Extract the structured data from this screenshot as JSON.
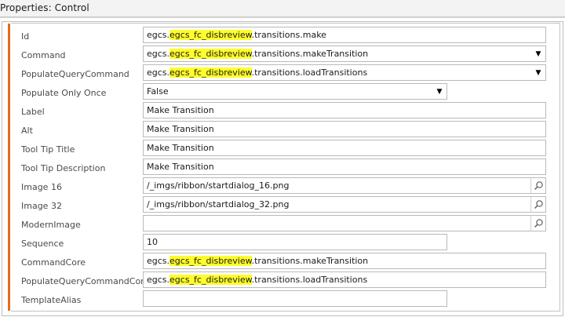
{
  "panel": {
    "title": "Properties: Control"
  },
  "properties": {
    "id": {
      "label": "Id",
      "prefix": "egcs.",
      "highlight": "egcs_fc_disbreview",
      "suffix": ".transitions.make"
    },
    "command": {
      "label": "Command",
      "prefix": "egcs.",
      "highlight": "egcs_fc_disbreview",
      "suffix": ".transitions.makeTransition"
    },
    "populate_query_command": {
      "label": "PopulateQueryCommand",
      "prefix": "egcs.",
      "highlight": "egcs_fc_disbreview",
      "suffix": ".transitions.loadTransitions"
    },
    "populate_only_once": {
      "label": "Populate Only Once",
      "value": "False"
    },
    "label": {
      "label": "Label",
      "value": "Make Transition"
    },
    "alt": {
      "label": "Alt",
      "value": "Make Transition"
    },
    "tool_tip_title": {
      "label": "Tool Tip Title",
      "value": "Make Transition"
    },
    "tool_tip_description": {
      "label": "Tool Tip Description",
      "value": "Make Transition"
    },
    "image_16": {
      "label": "Image 16",
      "value": "/_imgs/ribbon/startdialog_16.png"
    },
    "image_32": {
      "label": "Image 32",
      "value": "/_imgs/ribbon/startdialog_32.png"
    },
    "modern_image": {
      "label": "ModernImage",
      "value": ""
    },
    "sequence": {
      "label": "Sequence",
      "value": "10"
    },
    "command_core": {
      "label": "CommandCore",
      "prefix": "egcs.",
      "highlight": "egcs_fc_disbreview",
      "suffix": ".transitions.makeTransition"
    },
    "populate_query_command_core": {
      "label": "PopulateQueryCommandCore",
      "prefix": "egcs.",
      "highlight": "egcs_fc_disbreview",
      "suffix": ".transitions.loadTransitions"
    },
    "template_alias": {
      "label": "TemplateAlias",
      "value": ""
    }
  },
  "icons": {
    "dropdown": "triangle-down-icon",
    "lookup": "magnifier-icon"
  },
  "colors": {
    "accent_bar": "#e26d1f",
    "highlight": "#fffd2a"
  }
}
